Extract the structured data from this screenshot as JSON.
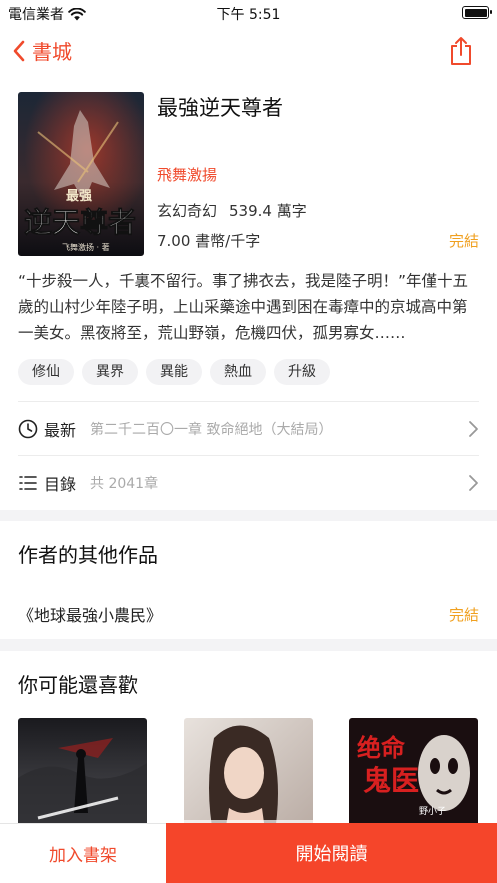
{
  "status_bar": {
    "carrier": "電信業者",
    "time": "下午 5:51"
  },
  "nav": {
    "back_label": "書城"
  },
  "book": {
    "title": "最強逆天尊者",
    "cover_title": "逆天尊者",
    "cover_small": "最强",
    "cover_credit": "飞舞激扬 · 著",
    "author": "飛舞激揚",
    "genre": "玄幻奇幻",
    "word_count": "539.4 萬字",
    "price": "7.00 書幣/千字",
    "status": "完結",
    "description": "“十步殺一人，千裏不留行。事了拂衣去，我是陸子明！”年僅十五歲的山村少年陸子明，上山采藥途中遇到困在毒瘴中的京城高中第一美女。黑夜將至，荒山野嶺，危機四伏，孤男寡女……",
    "tags": [
      "修仙",
      "異界",
      "異能",
      "熱血",
      "升級"
    ]
  },
  "rows": {
    "latest_label": "最新",
    "latest_value": "第二千二百〇一章 致命絕地（大結局）",
    "toc_label": "目錄",
    "toc_value": "共 2041章"
  },
  "other_works": {
    "title": "作者的其他作品",
    "book": "《地球最強小農民》",
    "status": "完結"
  },
  "recommend": {
    "title": "你可能還喜歡",
    "covers": [
      {
        "icon": "dark-warrior-cover"
      },
      {
        "icon": "woman-portrait-cover"
      },
      {
        "text": "绝命鬼医",
        "credit": "野小子"
      }
    ]
  },
  "bottom": {
    "add_label": "加入書架",
    "read_label": "開始閱讀"
  },
  "colors": {
    "accent": "#f04a2c",
    "done": "#f0a020",
    "read_button": "#f5452a"
  }
}
